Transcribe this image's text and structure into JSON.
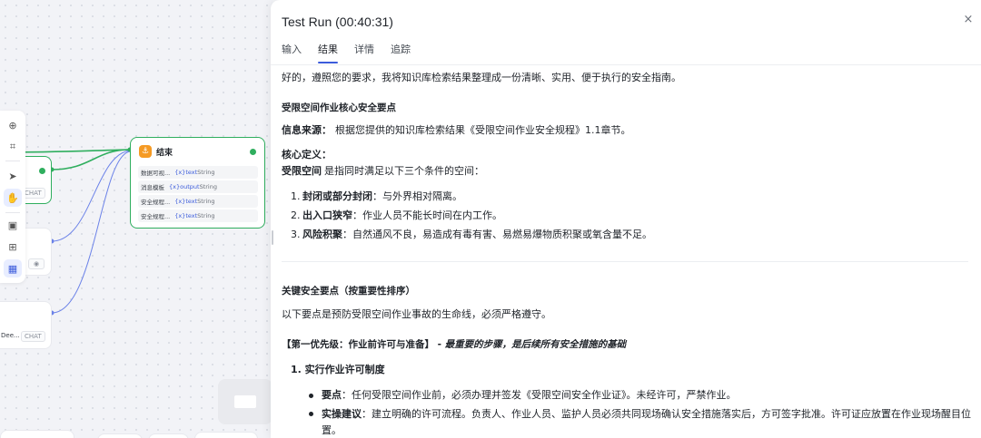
{
  "canvas": {
    "toolbar": {
      "icons": [
        "add-circle-icon",
        "note-icon",
        "pointer-icon",
        "hand-icon",
        "image-icon",
        "layout-icon",
        "minimap-icon"
      ],
      "active": "hand-icon"
    },
    "left_node_top": {
      "chip": "CHAT"
    },
    "left_node_bottom": {
      "text": "Dee...",
      "chip": "CHAT"
    },
    "end_node": {
      "title": "结束",
      "params": [
        {
          "name": "数据可视...",
          "var": "{x}text",
          "type": "String"
        },
        {
          "name": "消息模板",
          "var": "{x}output",
          "type": "String"
        },
        {
          "name": "安全规程...",
          "var": "{x}text",
          "type": "String"
        },
        {
          "name": "安全规程...",
          "var": "{x}text",
          "type": "String"
        }
      ]
    },
    "colors": {
      "edge_active": "#2fae5e",
      "edge_idle": "#6b82e8",
      "accent": "#3b5bdb"
    }
  },
  "panel": {
    "title": "Test Run (00:40:31)",
    "close": "×",
    "tabs": [
      "输入",
      "结果",
      "详情",
      "追踪"
    ],
    "active_tab": "结果",
    "result": {
      "intro": "好的，遵照您的要求，我将知识库检索结果整理成一份清晰、实用、便于执行的安全指南。",
      "h1": "受限空间作业核心安全要点",
      "source_label": "信息来源：",
      "source_text": "根据您提供的知识库检索结果《受限空间作业安全规程》1.1章节。",
      "def_title": "核心定义：",
      "def_term": "受限空间",
      "def_text": "是指同时满足以下三个条件的空间：",
      "conditions": [
        {
          "n": "1.",
          "term": "封闭或部分封闭",
          "text": "：与外界相对隔离。"
        },
        {
          "n": "2.",
          "term": "出入口狭窄",
          "text": "：作业人员不能长时间在内工作。"
        },
        {
          "n": "3.",
          "term": "风险积聚",
          "text": "：自然通风不良，易造成有毒有害、易燃易爆物质积聚或氧含量不足。"
        }
      ],
      "h2": "关键安全要点（按重要性排序）",
      "h2_desc": "以下要点是预防受限空间作业事故的生命线，必须严格遵守。",
      "p1_label": "【第一优先级：作业前许可与准备】",
      "p1_dash": " - ",
      "p1_emph": "最重要的步骤，是后续所有安全措施的基础",
      "item1": "1. 实行作业许可制度",
      "bullets": [
        {
          "term": "要点",
          "text": "：任何受限空间作业前，必须办理并签发《受限空间安全作业证》。未经许可，严禁作业。"
        },
        {
          "term": "实操建议",
          "text": "：建立明确的许可流程。负责人、作业人员、监护人员必须共同现场确认安全措施落实后，方可签字批准。许可证应放置在作业现场醒目位置。"
        }
      ]
    }
  }
}
